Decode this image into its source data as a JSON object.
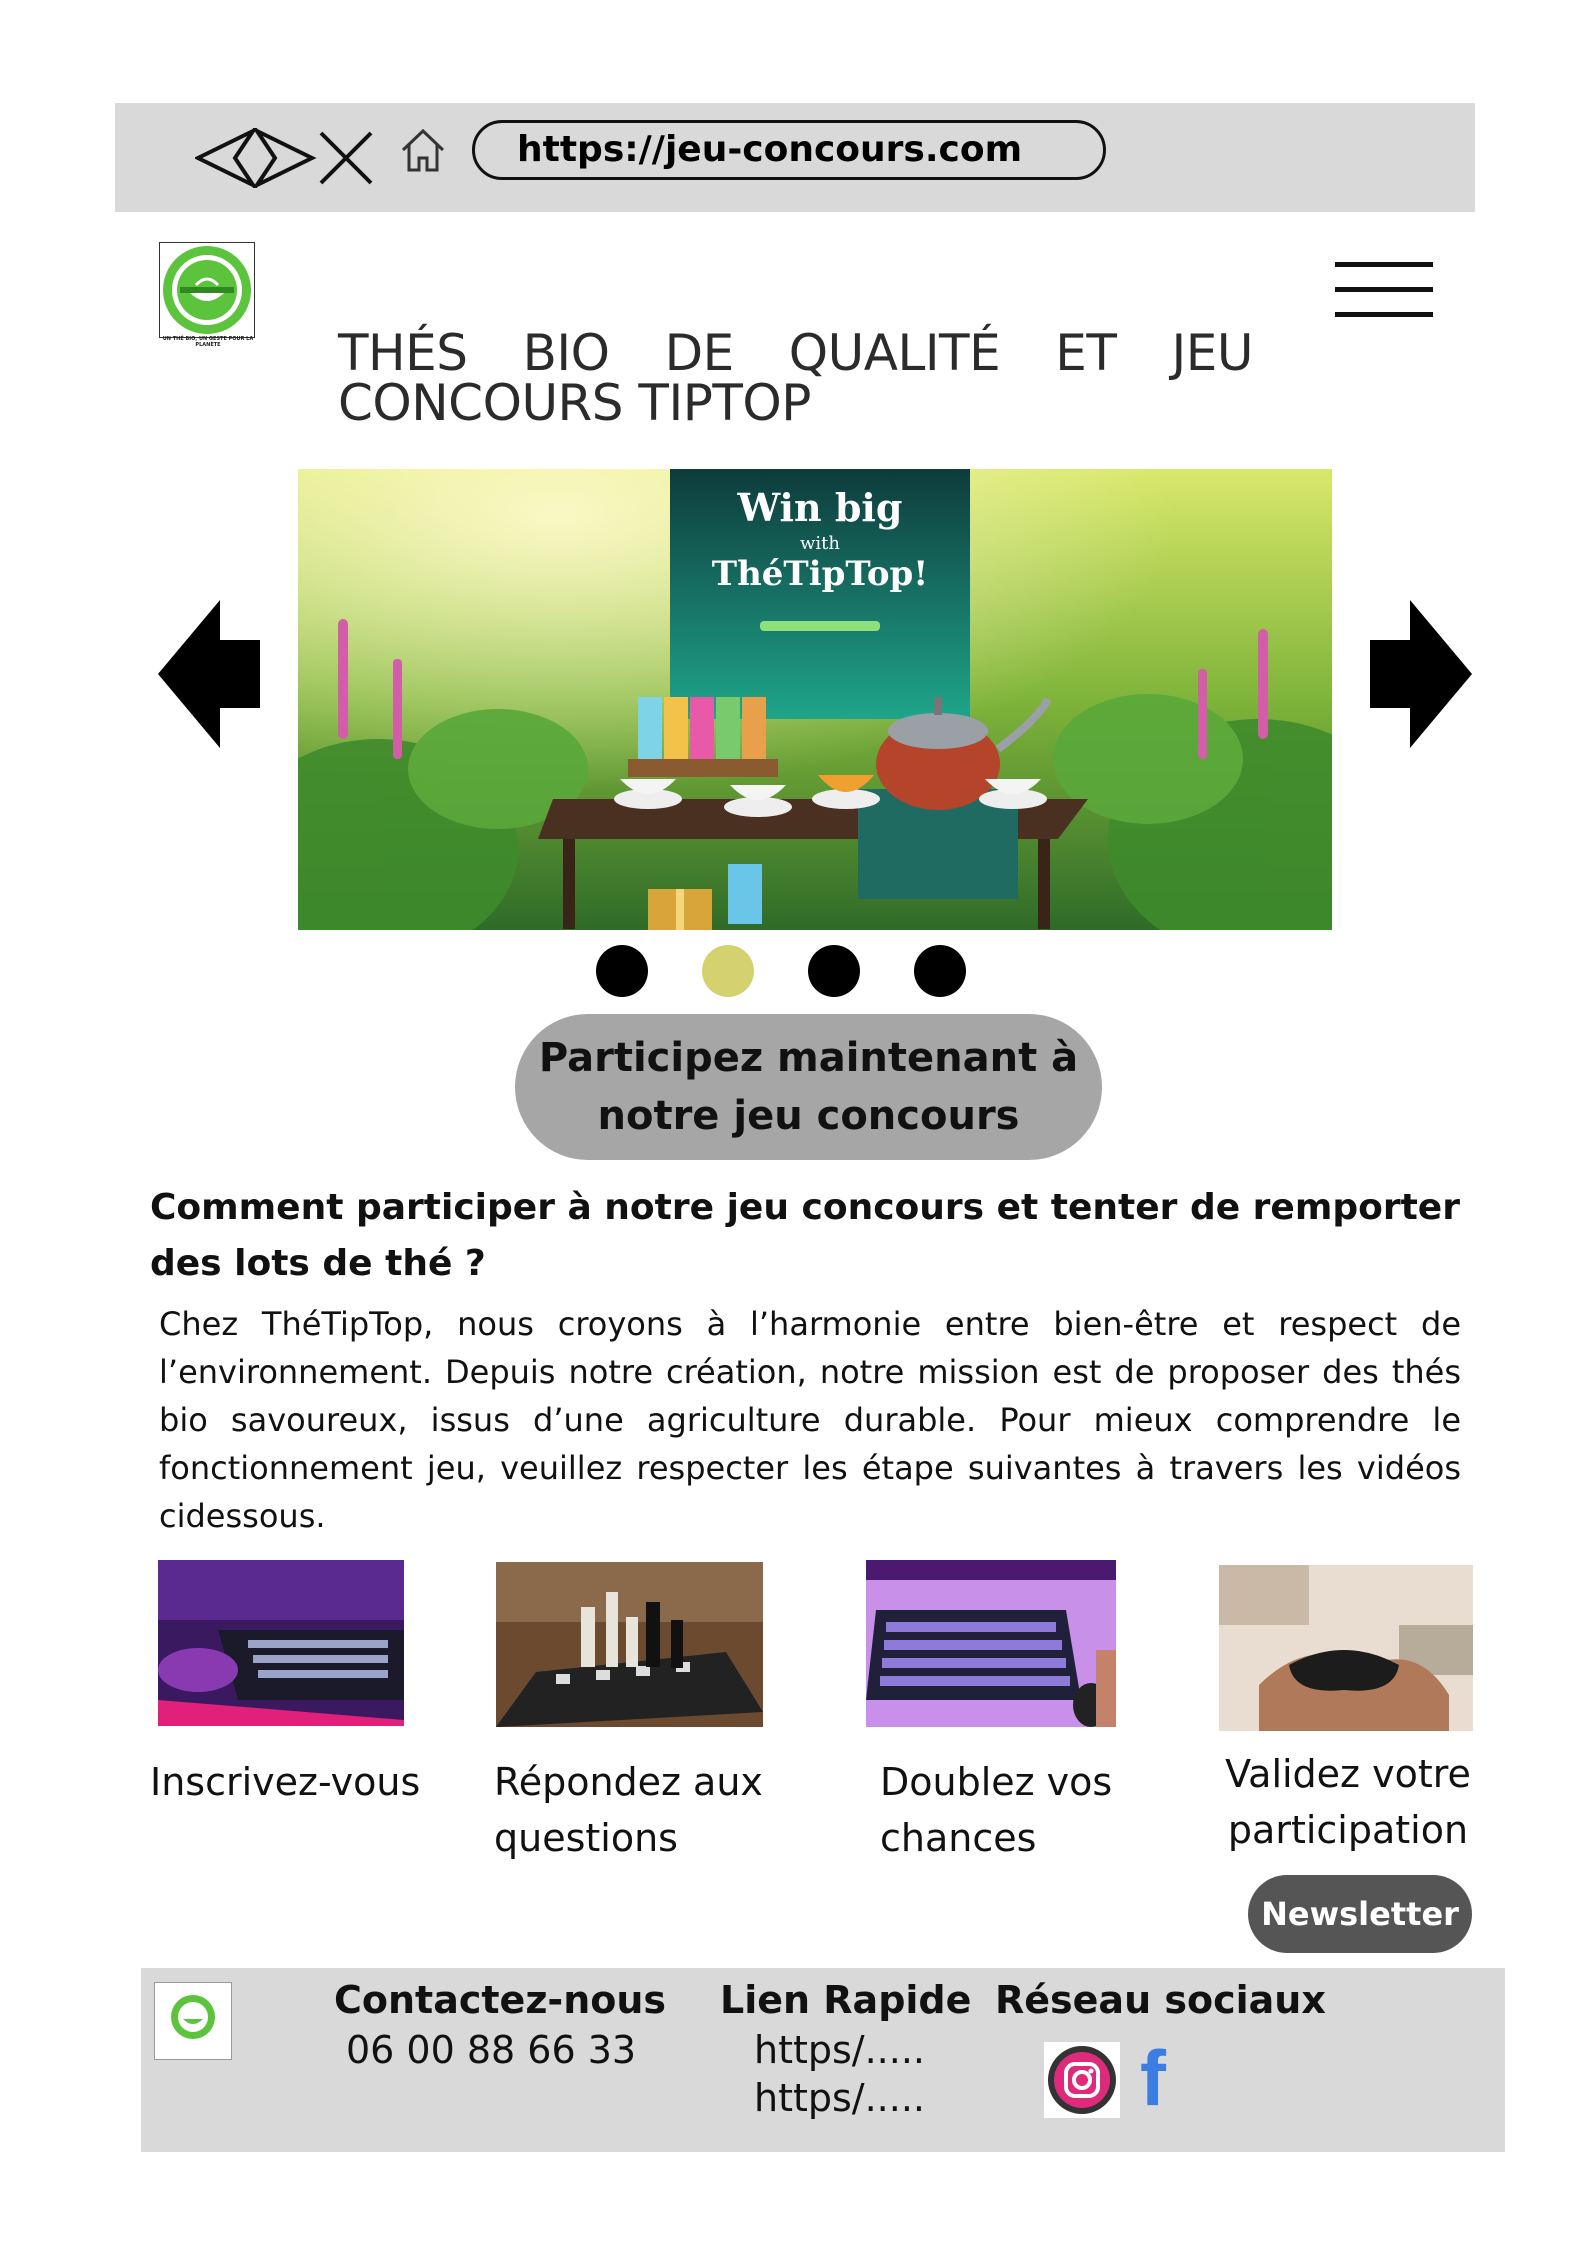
{
  "browser": {
    "url": "https://jeu-concours.com",
    "icons": [
      "back-chevron-icon",
      "forward-chevron-icon",
      "close-icon",
      "home-icon"
    ]
  },
  "header": {
    "logo_caption": "UN THÉ BIO, UN GESTE POUR LA PLANÈTE",
    "title": "THÉS BIO DE QUALITÉ ET JEU CONCOURS TIPTOP",
    "menu_icon": "hamburger-icon"
  },
  "carousel": {
    "banner_line1": "Win big",
    "banner_line2": "with",
    "banner_line3": "ThéTipTop!",
    "slide_count": 4,
    "active_slide_index": 1,
    "active_dot_color": "#d4d26e",
    "dot_color": "#000000"
  },
  "cta": {
    "label": "Participez maintenant à notre jeu concours"
  },
  "intro": {
    "heading": "Comment participer à notre jeu concours et tenter de remporter des lots de thé ?",
    "body": "Chez ThéTipTop, nous croyons à l’harmonie entre bien-être et respect de l’environnement. Depuis notre création, notre mission est de proposer des thés bio savoureux, issus d’une agriculture durable. Pour mieux comprendre le fonctionnement jeu, veuillez respecter les étape suivantes à travers les vidéos cidessous."
  },
  "steps": [
    {
      "label": "Inscrivez-vous"
    },
    {
      "label": "Répondez aux questions"
    },
    {
      "label": "Doublez vos chances"
    },
    {
      "label": "Validez votre participation"
    }
  ],
  "newsletter": {
    "label": "Newsletter"
  },
  "footer": {
    "contact_heading": "Contactez-nous",
    "phone": "06 00 88 66 33",
    "links_heading": "Lien Rapide",
    "links": [
      "https/.....",
      "https/....."
    ],
    "social_heading": "Réseau sociaux",
    "social_icons": [
      "instagram-icon",
      "facebook-icon"
    ],
    "facebook_glyph": "f"
  },
  "colors": {
    "bar_gray": "#d9d9d9",
    "cta_gray": "#a6a6a6",
    "newsletter_bg": "#555555",
    "brand_green": "#5cc43c",
    "facebook_blue": "#3b7de0"
  }
}
